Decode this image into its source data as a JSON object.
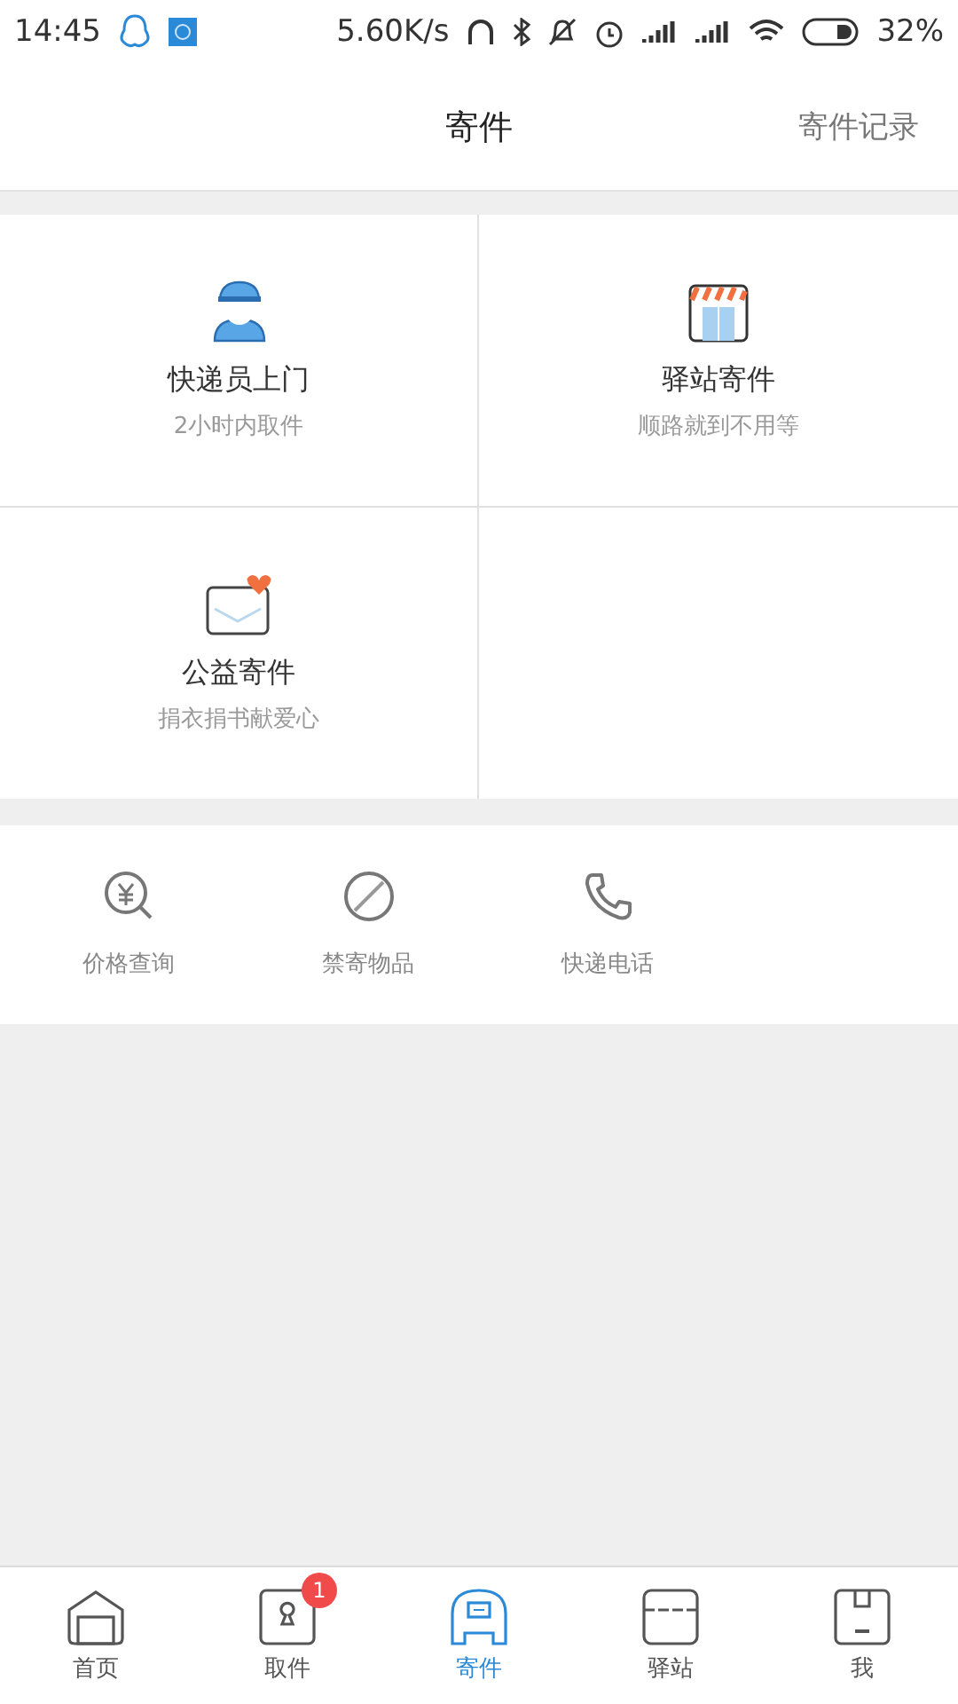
{
  "status_bar": {
    "time": "14:45",
    "speed": "5.60K/s",
    "battery": "32%"
  },
  "header": {
    "title": "寄件",
    "action": "寄件记录"
  },
  "services": [
    {
      "kind": "courier",
      "title": "快递员上门",
      "subtitle": "2小时内取件"
    },
    {
      "kind": "station",
      "title": "驿站寄件",
      "subtitle": "顺路就到不用等"
    },
    {
      "kind": "charity",
      "title": "公益寄件",
      "subtitle": "捐衣捐书献爱心"
    }
  ],
  "tools": [
    {
      "kind": "price",
      "label": "价格查询"
    },
    {
      "kind": "banned",
      "label": "禁寄物品"
    },
    {
      "kind": "phone",
      "label": "快递电话"
    }
  ],
  "tab_bar": [
    {
      "kind": "home",
      "label": "首页",
      "selected": false
    },
    {
      "kind": "pickup",
      "label": "取件",
      "selected": false,
      "badge": "1"
    },
    {
      "kind": "send",
      "label": "寄件",
      "selected": true
    },
    {
      "kind": "station",
      "label": "驿站",
      "selected": false
    },
    {
      "kind": "me",
      "label": "我",
      "selected": false
    }
  ]
}
